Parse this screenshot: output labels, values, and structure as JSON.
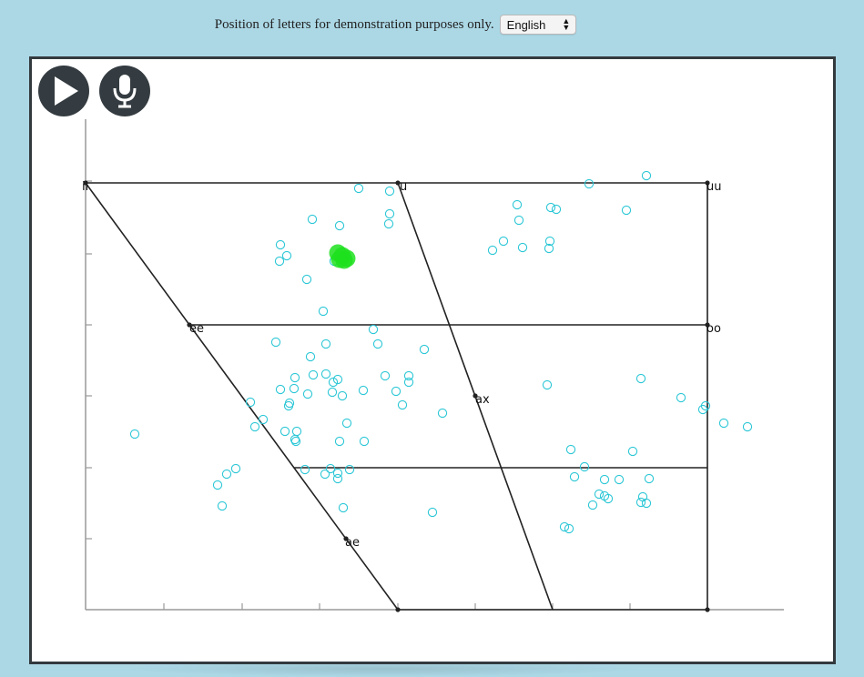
{
  "top_bar": {
    "caption": "Position of letters for demonstration purposes only.",
    "language_select": {
      "selected": "English"
    }
  },
  "controls": {
    "play_icon": "play-icon",
    "mic_icon": "microphone-icon"
  },
  "vowel_chart": {
    "labels": {
      "ii": "ii",
      "u": "u",
      "uu": "uu",
      "ee": "ee",
      "oo": "oo",
      "ax": "ax",
      "ae": "ae"
    },
    "colors": {
      "grid_line": "#222222",
      "axis": "#999999",
      "sample_marker": "#2cc7d6",
      "current_marker": "#1ee01e"
    }
  }
}
